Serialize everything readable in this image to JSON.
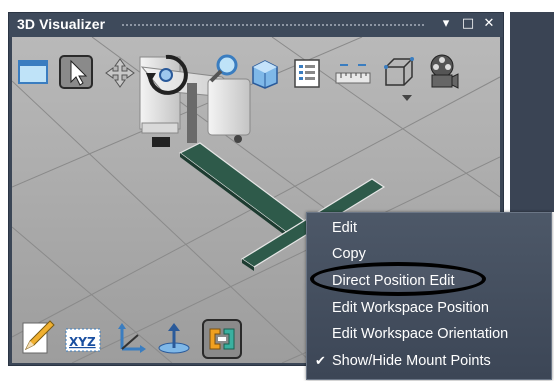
{
  "window": {
    "title": "3D Visualizer",
    "controls": {
      "dropdown": "▾",
      "maximize": "□",
      "close": "✕"
    }
  },
  "toolbar_top": [
    {
      "name": "view-window-icon"
    },
    {
      "name": "select-pointer-icon"
    },
    {
      "name": "pan-arrows-icon"
    },
    {
      "name": "rotate-icon"
    },
    {
      "name": "zoom-magnifier-icon"
    },
    {
      "name": "cube-icon"
    },
    {
      "name": "list-panel-icon"
    },
    {
      "name": "ruler-icon"
    },
    {
      "name": "wireframe-box-icon"
    },
    {
      "name": "film-reel-icon"
    }
  ],
  "toolbar_bottom": [
    {
      "name": "edit-pencil-icon"
    },
    {
      "name": "xyz-coordinate-icon",
      "text": "XYZ"
    },
    {
      "name": "axes-icon"
    },
    {
      "name": "mount-point-icon"
    },
    {
      "name": "connect-bracket-icon"
    }
  ],
  "context_menu": {
    "items": [
      {
        "label": "Edit",
        "checked": false
      },
      {
        "label": "Copy",
        "checked": false
      },
      {
        "label": "Direct Position Edit",
        "checked": false,
        "highlighted": true
      },
      {
        "label": "Edit Workspace Position",
        "checked": false
      },
      {
        "label": "Edit Workspace Orientation",
        "checked": false
      },
      {
        "label": "Show/Hide Mount Points",
        "checked": true,
        "check_glyph": "✔"
      }
    ]
  },
  "colors": {
    "viewport_bg": "#a8a8a8",
    "frame": "#3b4656",
    "menu_bg": "#4a5565",
    "conveyor": "#2e5a4a"
  }
}
